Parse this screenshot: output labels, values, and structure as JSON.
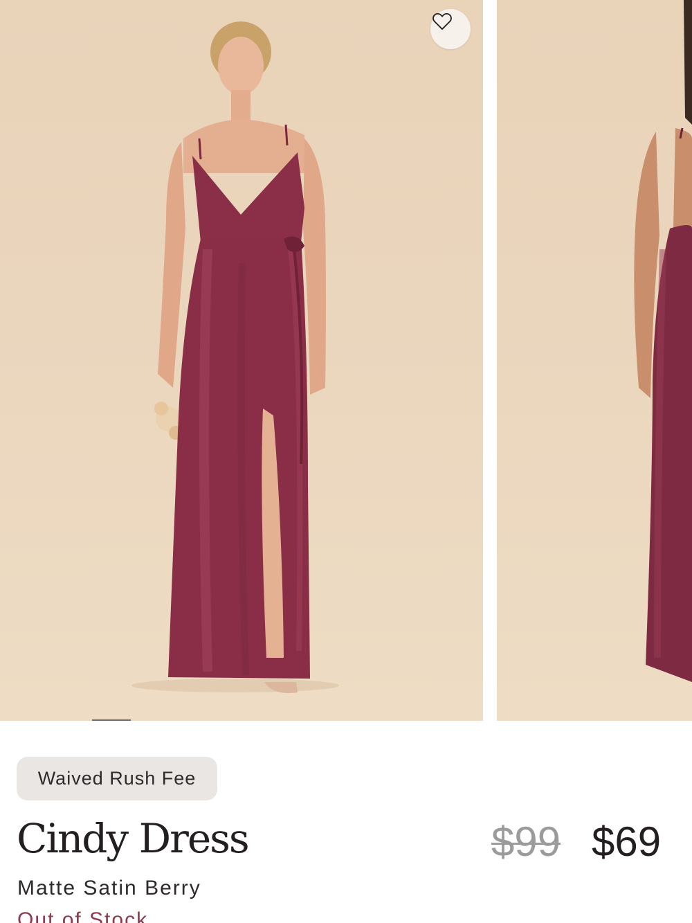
{
  "product": {
    "badge": "Waived Rush Fee",
    "name": "Cindy Dress",
    "color": "Matte Satin Berry",
    "price_original": "$99",
    "price_sale": "$69",
    "stock_status": "Out of Stock"
  },
  "gallery": {
    "wishlist_icon": "heart-outline-icon",
    "slide_count_visible": 2
  },
  "colors": {
    "background": "#ead6bd",
    "dress": "#8b2f48",
    "badge_bg": "#eae6e3",
    "text": "#231f20",
    "price_old": "#9b9b9b"
  }
}
